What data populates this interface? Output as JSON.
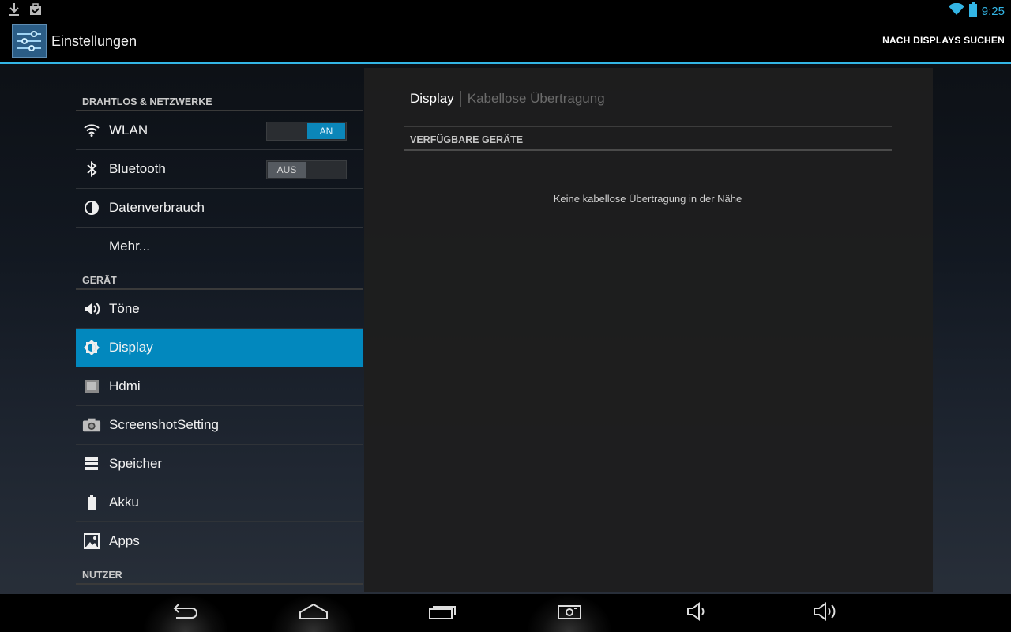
{
  "status_bar": {
    "time": "9:25",
    "icons_left": [
      "download-icon",
      "briefcase-check-icon"
    ],
    "icons_right": [
      "wifi-icon",
      "battery-icon"
    ]
  },
  "action_bar": {
    "title": "Einstellungen",
    "action": "NACH DISPLAYS SUCHEN"
  },
  "sidebar": {
    "sections": [
      {
        "header": "DRAHTLOS & NETZWERKE",
        "items": [
          {
            "label": "WLAN",
            "icon": "wifi-icon",
            "toggle": "AN"
          },
          {
            "label": "Bluetooth",
            "icon": "bluetooth-icon",
            "toggle": "AUS"
          },
          {
            "label": "Datenverbrauch",
            "icon": "data-usage-icon"
          },
          {
            "label": "Mehr..."
          }
        ]
      },
      {
        "header": "GERÄT",
        "items": [
          {
            "label": "Töne",
            "icon": "speaker-icon"
          },
          {
            "label": "Display",
            "icon": "brightness-icon",
            "selected": true
          },
          {
            "label": "Hdmi",
            "icon": "hdmi-icon"
          },
          {
            "label": "ScreenshotSetting",
            "icon": "camera-icon"
          },
          {
            "label": "Speicher",
            "icon": "storage-icon"
          },
          {
            "label": "Akku",
            "icon": "battery-icon"
          },
          {
            "label": "Apps",
            "icon": "apps-icon"
          }
        ]
      },
      {
        "header": "NUTZER",
        "items": []
      }
    ]
  },
  "main": {
    "breadcrumb_active": "Display",
    "breadcrumb_inactive": "Kabellose Übertragung",
    "section_header": "VERFÜGBARE GERÄTE",
    "empty_message": "Keine kabellose Übertragung in der Nähe"
  },
  "nav_bar": {
    "buttons": [
      "back-icon",
      "home-icon",
      "recent-apps-icon",
      "screenshot-icon",
      "volume-down-icon",
      "volume-up-icon"
    ]
  },
  "colors": {
    "accent": "#33b5e5",
    "selected": "#0288be"
  }
}
